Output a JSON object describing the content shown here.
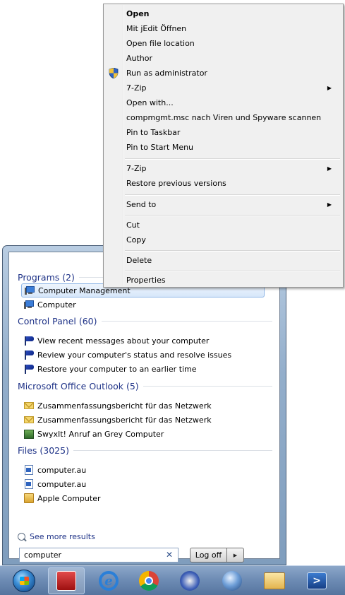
{
  "context_menu": {
    "items": [
      {
        "label": "Open"
      },
      {
        "label": "Mit jEdit Öffnen"
      },
      {
        "label": "Open file location"
      },
      {
        "label": "Author"
      },
      {
        "label": "Run as administrator"
      },
      {
        "label": "7-Zip"
      },
      {
        "label": "Open with..."
      },
      {
        "label": "compmgmt.msc nach Viren und Spyware scannen"
      },
      {
        "label": "Pin to Taskbar"
      },
      {
        "label": "Pin to Start Menu"
      },
      {
        "label": "7-Zip"
      },
      {
        "label": "Restore previous versions"
      },
      {
        "label": "Send to"
      },
      {
        "label": "Cut"
      },
      {
        "label": "Copy"
      },
      {
        "label": "Delete"
      },
      {
        "label": "Properties"
      }
    ]
  },
  "start_menu": {
    "categories": [
      {
        "header": "Programs (2)",
        "items": [
          {
            "label": "Computer Management",
            "icon": "computer-management-icon"
          },
          {
            "label": "Computer",
            "icon": "computer-icon"
          }
        ]
      },
      {
        "header": "Control Panel (60)",
        "items": [
          {
            "label": "View recent messages about your computer",
            "icon": "action-center-flag-icon"
          },
          {
            "label": "Review your computer's status and resolve issues",
            "icon": "action-center-flag-icon"
          },
          {
            "label": "Restore your computer to an earlier time",
            "icon": "action-center-flag-icon"
          }
        ]
      },
      {
        "header": "Microsoft Office Outlook (5)",
        "items": [
          {
            "label": "Zusammenfassungsbericht für das Netzwerk",
            "icon": "mail-icon"
          },
          {
            "label": "Zusammenfassungsbericht für das Netzwerk",
            "icon": "mail-icon"
          },
          {
            "label": "SwyxIt! Anruf an Grey Computer",
            "icon": "swyxit-icon"
          }
        ]
      },
      {
        "header": "Files (3025)",
        "items": [
          {
            "label": "computer.au",
            "icon": "audio-file-icon"
          },
          {
            "label": "computer.au",
            "icon": "audio-file-icon"
          },
          {
            "label": "Apple Computer",
            "icon": "folder-icon"
          }
        ]
      }
    ],
    "see_more": "See more results",
    "search": {
      "value": "computer"
    },
    "logoff_label": "Log off"
  },
  "taskbar": {
    "icons": [
      "start-orb-icon",
      "swyxit-icon",
      "internet-explorer-icon",
      "chrome-icon",
      "people-icon",
      "globe-icon",
      "file-explorer-icon",
      "powershell-icon"
    ]
  }
}
